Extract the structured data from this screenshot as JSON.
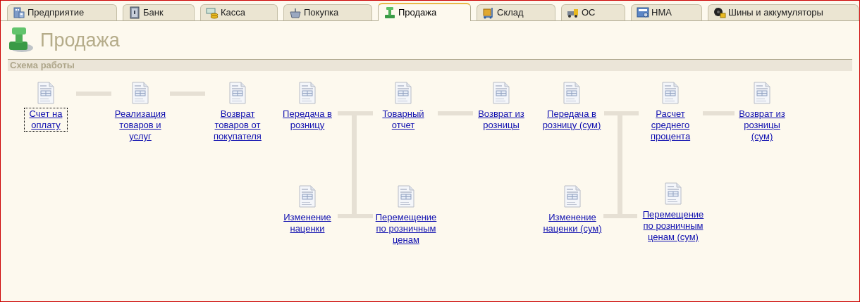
{
  "tabs": [
    {
      "label": "Предприятие",
      "selected": false
    },
    {
      "label": "Банк",
      "selected": false
    },
    {
      "label": "Касса",
      "selected": false
    },
    {
      "label": "Покупка",
      "selected": false
    },
    {
      "label": "Продажа",
      "selected": true
    },
    {
      "label": "Склад",
      "selected": false
    },
    {
      "label": "ОС",
      "selected": false
    },
    {
      "label": "НМА",
      "selected": false
    },
    {
      "label": "Шины и аккумуляторы",
      "selected": false
    }
  ],
  "page": {
    "title": "Продажа"
  },
  "section": {
    "title": "Схема работы"
  },
  "nodes": [
    {
      "label": "Счет на оплату",
      "focused": true
    },
    {
      "label": "Реализация товаров и услуг",
      "focused": false
    },
    {
      "label": "Возврат товаров от покупателя",
      "focused": false
    },
    {
      "label": "Передача в розницу",
      "focused": false
    },
    {
      "label": "Товарный отчет",
      "focused": false
    },
    {
      "label": "Возврат из розницы",
      "focused": false
    },
    {
      "label": "Передача в розницу (сум)",
      "focused": false
    },
    {
      "label": "Расчет среднего процента",
      "focused": false
    },
    {
      "label": "Возврат из розницы (сум)",
      "focused": false
    },
    {
      "label": "Изменение наценки",
      "focused": false
    },
    {
      "label": "Перемещение по розничным ценам",
      "focused": false
    },
    {
      "label": "Изменение наценки (сум)",
      "focused": false
    },
    {
      "label": "Перемещение по розничным ценам (сум)",
      "focused": false
    }
  ]
}
